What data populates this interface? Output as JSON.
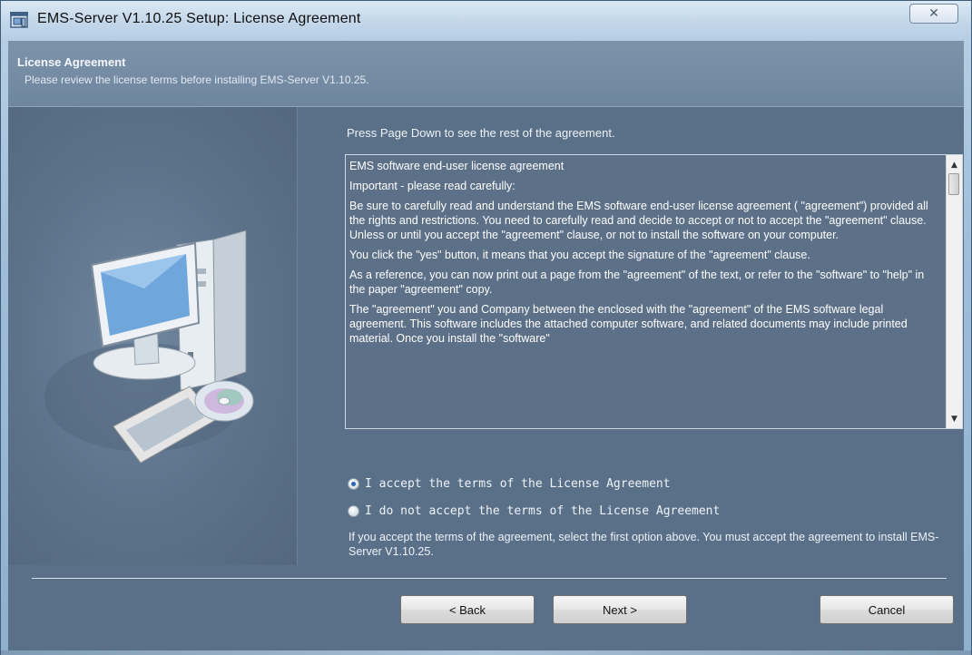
{
  "window": {
    "title": "EMS-Server V1.10.25 Setup: License Agreement",
    "close_glyph": "✕"
  },
  "header": {
    "title": "License Agreement",
    "subtitle": "Please review the license terms before installing EMS-Server V1.10.25."
  },
  "main": {
    "instruction": "Press Page Down to see the rest of the agreement.",
    "license_paragraphs": [
      "EMS software end-user license agreement",
      "Important - please read carefully:",
      " Be sure to carefully read and understand the EMS software end-user license agreement ( \"agreement\") provided all the rights and restrictions. You need to carefully read and decide to accept or not to accept the \"agreement\" clause. Unless or until you accept the \"agreement\" clause, or not to install the software on your computer.",
      " You click the \"yes\" button, it means that you accept the signature of the \"agreement\" clause.",
      " As a reference, you can now print out a page from the \"agreement\" of the text, or refer to the \"software\" to \"help\" in the paper \"agreement\" copy.",
      " The \"agreement\" you and Company between the enclosed with the \"agreement\" of the EMS software legal agreement. This software includes the attached computer software, and related documents may include printed material. Once you install the \"software\""
    ],
    "radio_accept": "I accept the terms of the License Agreement",
    "radio_decline": "I do not accept the terms of the License Agreement",
    "selected": "accept",
    "note": "If you accept the terms of the agreement, select the first option above. You must accept the agreement to install EMS-Server V1.10.25."
  },
  "buttons": {
    "back": "< Back",
    "next": "Next >",
    "cancel": "Cancel"
  },
  "icons": {
    "app": "installer-icon",
    "art": "computer-with-cd-illustration",
    "scroll_up": "scroll-up-arrow-icon",
    "scroll_down": "scroll-down-arrow-icon"
  }
}
